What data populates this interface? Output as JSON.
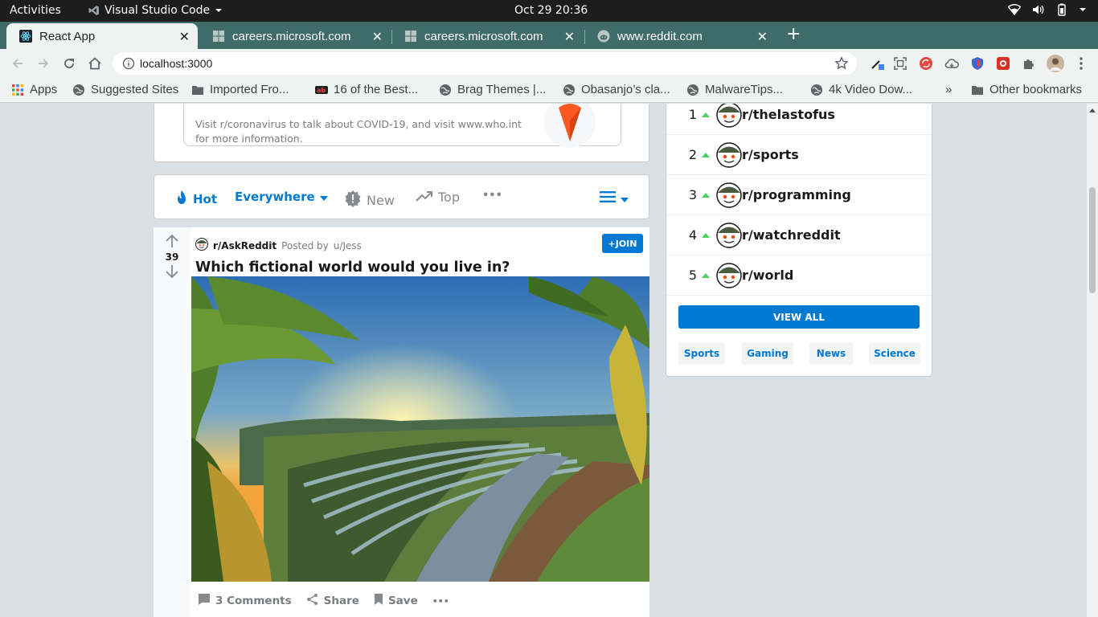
{
  "system": {
    "activities": "Activities",
    "app_name": "Visual Studio Code",
    "clock": "Oct 29  20:36"
  },
  "browser": {
    "tabs": [
      {
        "title": "React App",
        "active": true
      },
      {
        "title": "careers.microsoft.com",
        "active": false
      },
      {
        "title": "careers.microsoft.com",
        "active": false
      },
      {
        "title": "www.reddit.com",
        "active": false
      }
    ],
    "new_tab": "+",
    "url": "localhost:3000",
    "bookmarks": [
      {
        "label": "Apps"
      },
      {
        "label": "Suggested Sites"
      },
      {
        "label": "Imported Fro..."
      },
      {
        "label": "16 of the Best..."
      },
      {
        "label": "Brag Themes |..."
      },
      {
        "label": "Obasanjo’s cla..."
      },
      {
        "label": "MalwareTips..."
      },
      {
        "label": "4k Video Dow..."
      }
    ],
    "overflow": "»",
    "other_bookmarks": "Other bookmarks"
  },
  "covid": {
    "text": "Visit r/coronavirus to talk about COVID-19, and visit www.who.int for more information."
  },
  "sort_bar": {
    "hot": "Hot",
    "location": "Everywhere",
    "new": "New",
    "top": "Top",
    "more": "•••"
  },
  "post": {
    "votes": "39",
    "subreddit": "r/AskReddit",
    "posted_by": "Posted by",
    "author": "u/Jess",
    "join": "+JOIN",
    "title": "Which fictional world would you live in?",
    "comments": "3 Comments",
    "share": "Share",
    "save": "Save",
    "more": "•••"
  },
  "communities": [
    {
      "rank": "1",
      "name": "r/thelastofus"
    },
    {
      "rank": "2",
      "name": "r/sports"
    },
    {
      "rank": "3",
      "name": "r/programming"
    },
    {
      "rank": "4",
      "name": "r/watchreddit"
    },
    {
      "rank": "5",
      "name": "r/world"
    }
  ],
  "view_all": "VIEW ALL",
  "categories": [
    "Sports",
    "Gaming",
    "News",
    "Science"
  ],
  "colors": {
    "reddit_blue": "#0079d3",
    "tab_strip": "#3f6b68",
    "page_bg": "#dae0e6",
    "upvote_green": "#46d160"
  }
}
